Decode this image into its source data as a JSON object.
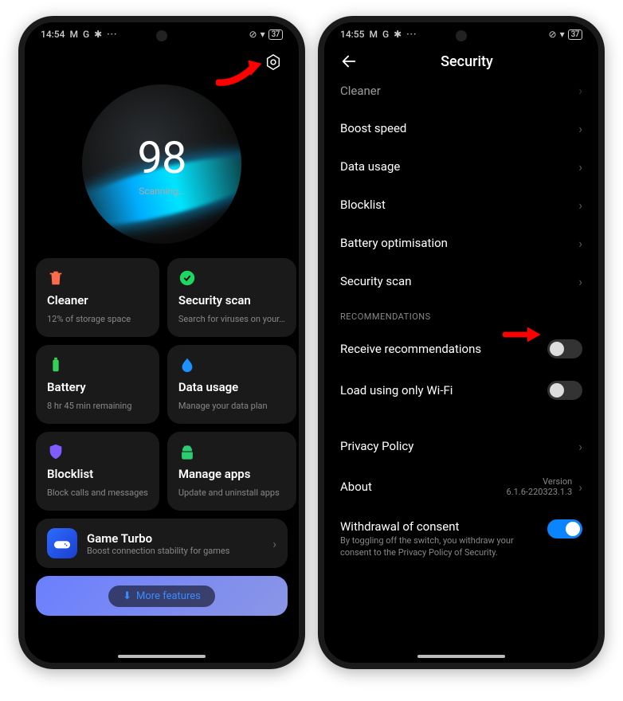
{
  "left": {
    "status": {
      "time": "14:54",
      "icons": [
        "M",
        "G",
        "✱"
      ],
      "battery": "37"
    },
    "header": {
      "settings_icon": "settings"
    },
    "orb": {
      "score": "98",
      "label": "Scanning…"
    },
    "tiles": [
      {
        "id": "cleaner",
        "title": "Cleaner",
        "sub": "12% of storage space",
        "icon": "trash",
        "icon_color": "#ff6b4a"
      },
      {
        "id": "security-scan",
        "title": "Security scan",
        "sub": "Search for viruses on your…",
        "icon": "check",
        "icon_color": "#1ed760"
      },
      {
        "id": "battery",
        "title": "Battery",
        "sub": "8 hr 45 min  remaining",
        "icon": "battery",
        "icon_color": "#34d058"
      },
      {
        "id": "data-usage",
        "title": "Data usage",
        "sub": "Manage your data plan",
        "icon": "drop",
        "icon_color": "#1e90ff"
      },
      {
        "id": "blocklist",
        "title": "Blocklist",
        "sub": "Block calls and messages",
        "icon": "shield",
        "icon_color": "#7f5cff"
      },
      {
        "id": "manage-apps",
        "title": "Manage apps",
        "sub": "Update and uninstall apps",
        "icon": "android",
        "icon_color": "#2ecc71"
      }
    ],
    "turbo": {
      "title": "Game Turbo",
      "sub": "Boost connection stability for games"
    },
    "more_features": "More features"
  },
  "right": {
    "status": {
      "time": "14:55",
      "icons": [
        "M",
        "G",
        "✱"
      ],
      "battery": "37"
    },
    "title": "Security",
    "cutoff": "Cleaner",
    "rows": [
      {
        "id": "boost-speed",
        "label": "Boost speed",
        "type": "link"
      },
      {
        "id": "data-usage",
        "label": "Data usage",
        "type": "link"
      },
      {
        "id": "blocklist",
        "label": "Blocklist",
        "type": "link"
      },
      {
        "id": "battery-optimisation",
        "label": "Battery optimisation",
        "type": "link"
      },
      {
        "id": "security-scan",
        "label": "Security scan",
        "type": "link"
      }
    ],
    "section_header": "RECOMMENDATIONS",
    "toggles": [
      {
        "id": "receive-recommendations",
        "label": "Receive recommendations",
        "on": false
      },
      {
        "id": "load-wifi",
        "label": "Load using only Wi-Fi",
        "on": false
      }
    ],
    "bottom_rows": [
      {
        "id": "privacy-policy",
        "label": "Privacy Policy",
        "type": "link"
      },
      {
        "id": "about",
        "label": "About",
        "type": "link",
        "right_top": "Version",
        "right_bottom": "6.1.6-220323.1.3"
      }
    ],
    "consent": {
      "title": "Withdrawal of consent",
      "sub": "By toggling off the switch, you withdraw your consent to the Privacy Policy of Security.",
      "on": true
    }
  }
}
